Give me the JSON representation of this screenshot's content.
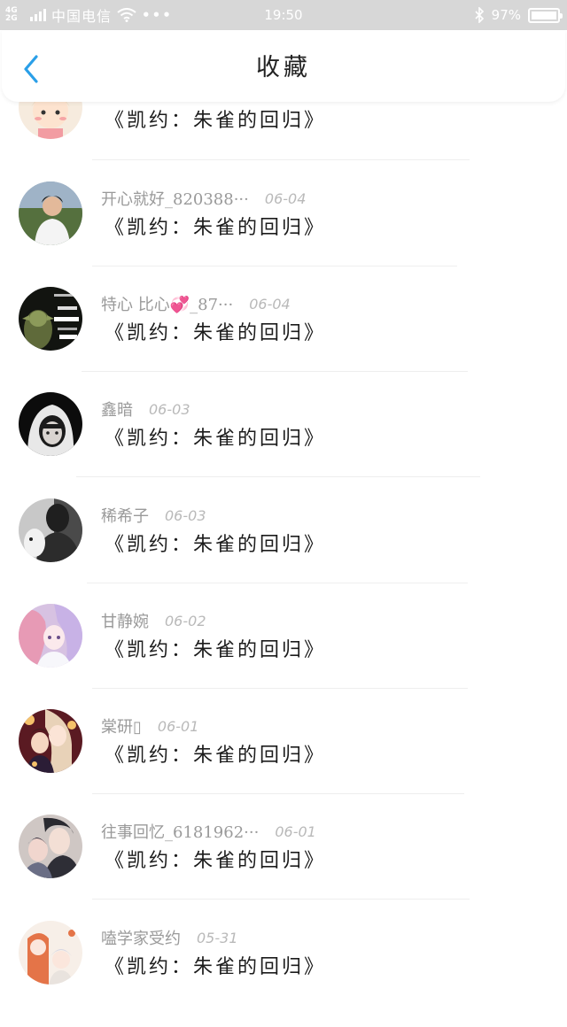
{
  "status_bar": {
    "network": "4G 2G",
    "carrier": "中国电信",
    "more": "•••",
    "time": "19:50",
    "battery": "97%"
  },
  "nav": {
    "title": "收藏"
  },
  "items": [
    {
      "name": "",
      "date": "",
      "title": "《凯约：朱雀的回归》",
      "avatar_color": "#f3e6d6"
    },
    {
      "name": "开心就好_820388···",
      "date": "06-04",
      "title": "《凯约：朱雀的回归》",
      "avatar_color": "#6b7d55"
    },
    {
      "name": "特心 比心💞_87···",
      "date": "06-04",
      "title": "《凯约：朱雀的回归》",
      "avatar_color": "#2a2a22"
    },
    {
      "name": "鑫暗",
      "date": "06-03",
      "title": "《凯约：朱雀的回归》",
      "avatar_color": "#1e1e1e"
    },
    {
      "name": "稀希子",
      "date": "06-03",
      "title": "《凯约：朱雀的回归》",
      "avatar_color": "#7d7d7d"
    },
    {
      "name": "甘静婉",
      "date": "06-02",
      "title": "《凯约：朱雀的回归》",
      "avatar_color": "#c9a7d8"
    },
    {
      "name": "棠研▯",
      "date": "06-01",
      "title": "《凯约：朱雀的回归》",
      "avatar_color": "#b5473a"
    },
    {
      "name": "往事回忆_6181962···",
      "date": "06-01",
      "title": "《凯约：朱雀的回归》",
      "avatar_color": "#4a4a52"
    },
    {
      "name": "嗑学家受约",
      "date": "05-31",
      "title": "《凯约：朱雀的回归》",
      "avatar_color": "#e98c5a"
    }
  ]
}
